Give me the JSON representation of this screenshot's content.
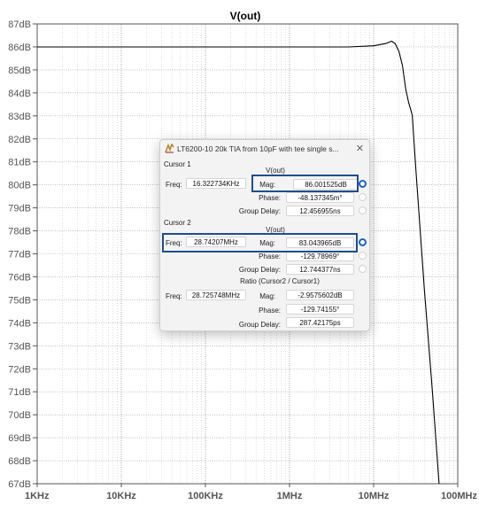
{
  "plot": {
    "trace_name": "V(out)",
    "y_ticks": [
      "87dB",
      "86dB",
      "85dB",
      "84dB",
      "83dB",
      "82dB",
      "81dB",
      "80dB",
      "79dB",
      "78dB",
      "77dB",
      "76dB",
      "75dB",
      "74dB",
      "73dB",
      "72dB",
      "71dB",
      "70dB",
      "69dB",
      "68dB",
      "67dB"
    ],
    "x_ticks": [
      "1KHz",
      "10KHz",
      "100KHz",
      "1MHz",
      "10MHz",
      "100MHz"
    ]
  },
  "chart_data": {
    "type": "line",
    "title": "V(out)",
    "xscale": "log",
    "xlim": [
      1000,
      100000000
    ],
    "ylim": [
      67,
      87
    ],
    "grid": true,
    "series": [
      {
        "name": "V(out)",
        "x": [
          1000,
          10000,
          100000,
          1000000,
          5000000,
          10000000,
          14000000,
          16300000,
          18000000,
          20000000,
          22000000,
          24000000,
          26000000,
          28742070,
          32000000,
          40000000,
          50000000,
          60000000
        ],
        "y": [
          86.0,
          86.0,
          86.0,
          86.0,
          86.0,
          86.05,
          86.15,
          86.25,
          86.15,
          85.8,
          85.2,
          84.2,
          83.6,
          83.04,
          80.5,
          75.5,
          71.0,
          67.0
        ]
      }
    ]
  },
  "dialog": {
    "title": "LT6200-10 20k TIA from 10pF with tee single s...",
    "close_glyph": "✕",
    "cursor1": {
      "heading": "Cursor 1",
      "trace": "V(out)",
      "freq_label": "Freq:",
      "freq": "16.322734KHz",
      "mag_label": "Mag:",
      "mag": "86.001525dB",
      "phase_label": "Phase:",
      "phase": "-48.137345m°",
      "gd_label": "Group Delay:",
      "gd": "12.456955ns"
    },
    "cursor2": {
      "heading": "Cursor 2",
      "trace": "V(out)",
      "freq_label": "Freq:",
      "freq": "28.74207MHz",
      "mag_label": "Mag:",
      "mag": "83.043965dB",
      "phase_label": "Phase:",
      "phase": "-129.78969°",
      "gd_label": "Group Delay:",
      "gd": "12.744377ns"
    },
    "ratio": {
      "heading": "Ratio (Cursor2 / Cursor1)",
      "freq_label": "Freq:",
      "freq": "28.725748MHz",
      "mag_label": "Mag:",
      "mag": "-2.9575602dB",
      "phase_label": "Phase:",
      "phase": "-129.74155°",
      "gd_label": "Group Delay:",
      "gd": "287.42175ps"
    }
  },
  "colors": {
    "highlight": "#1f4e8c",
    "radio_selected": "#1565c0",
    "trace": "#000000"
  }
}
